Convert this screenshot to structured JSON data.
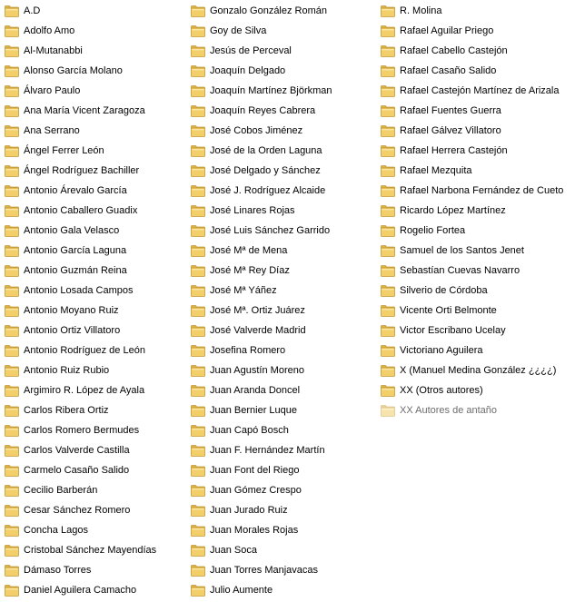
{
  "folder_icon": {
    "name": "folder-icon",
    "colors": {
      "tab": "#dcb24a",
      "body": "#f2cf6a",
      "edge": "#c29a34",
      "shine": "#fbe6a3"
    }
  },
  "columns": [
    {
      "items": [
        {
          "label": "A.D"
        },
        {
          "label": "Adolfo Amo"
        },
        {
          "label": "Al-Mutanabbi"
        },
        {
          "label": "Alonso García Molano"
        },
        {
          "label": "Álvaro Paulo"
        },
        {
          "label": "Ana María Vicent Zaragoza"
        },
        {
          "label": "Ana Serrano"
        },
        {
          "label": "Ángel Ferrer León"
        },
        {
          "label": "Ángel Rodríguez Bachiller"
        },
        {
          "label": "Antonio Árevalo García"
        },
        {
          "label": "Antonio Caballero Guadix"
        },
        {
          "label": "Antonio Gala Velasco"
        },
        {
          "label": "Antonio García Laguna"
        },
        {
          "label": "Antonio Guzmán Reina"
        },
        {
          "label": "Antonio Losada Campos"
        },
        {
          "label": "Antonio Moyano Ruiz"
        },
        {
          "label": "Antonio Ortiz Villatoro"
        },
        {
          "label": "Antonio Rodríguez de León"
        },
        {
          "label": "Antonio Ruiz Rubio"
        },
        {
          "label": "Argimiro R. López de Ayala"
        },
        {
          "label": "Carlos Ribera Ortiz"
        },
        {
          "label": "Carlos Romero Bermudes"
        },
        {
          "label": "Carlos Valverde Castilla"
        },
        {
          "label": "Carmelo Casaño Salido"
        },
        {
          "label": "Cecilio Barberán"
        },
        {
          "label": "Cesar Sánchez Romero"
        },
        {
          "label": "Concha Lagos"
        },
        {
          "label": "Cristobal Sánchez Mayendías"
        },
        {
          "label": "Dámaso Torres"
        },
        {
          "label": "Daniel Aguilera Camacho"
        }
      ]
    },
    {
      "items": [
        {
          "label": "Gonzalo González Román"
        },
        {
          "label": "Goy de Silva"
        },
        {
          "label": "Jesús de Perceval"
        },
        {
          "label": "Joaquín Delgado"
        },
        {
          "label": "Joaquín Martínez Björkman"
        },
        {
          "label": "Joaquín Reyes Cabrera"
        },
        {
          "label": "José Cobos Jiménez"
        },
        {
          "label": "José de la Orden Laguna"
        },
        {
          "label": "José Delgado y Sánchez"
        },
        {
          "label": "José J. Rodríguez Alcaide"
        },
        {
          "label": "José Linares Rojas"
        },
        {
          "label": "José Luis Sánchez Garrido"
        },
        {
          "label": "José Mª de Mena"
        },
        {
          "label": "José Mª Rey Díaz"
        },
        {
          "label": "José Mª Yáñez"
        },
        {
          "label": "José Mª. Ortiz Juárez"
        },
        {
          "label": "José Valverde Madrid"
        },
        {
          "label": "Josefina Romero"
        },
        {
          "label": "Juan Agustín Moreno"
        },
        {
          "label": "Juan Aranda Doncel"
        },
        {
          "label": "Juan Bernier Luque"
        },
        {
          "label": "Juan Capó Bosch"
        },
        {
          "label": "Juan F. Hernández Martín"
        },
        {
          "label": "Juan Font del Riego"
        },
        {
          "label": "Juan Gómez Crespo"
        },
        {
          "label": "Juan Jurado Ruiz"
        },
        {
          "label": "Juan Morales Rojas"
        },
        {
          "label": "Juan Soca"
        },
        {
          "label": "Juan Torres Manjavacas"
        },
        {
          "label": "Julio Aumente"
        }
      ]
    },
    {
      "items": [
        {
          "label": "R. Molina"
        },
        {
          "label": "Rafael Aguilar Priego"
        },
        {
          "label": "Rafael Cabello Castejón"
        },
        {
          "label": "Rafael Casaño Salido"
        },
        {
          "label": "Rafael Castejón Martínez de Arizala"
        },
        {
          "label": "Rafael Fuentes Guerra"
        },
        {
          "label": "Rafael Gálvez Villatoro"
        },
        {
          "label": "Rafael Herrera Castejón"
        },
        {
          "label": "Rafael Mezquita"
        },
        {
          "label": "Rafael Narbona Fernández de Cueto"
        },
        {
          "label": "Ricardo López Martínez"
        },
        {
          "label": "Rogelio Fortea"
        },
        {
          "label": "Samuel de los Santos Jenet"
        },
        {
          "label": "Sebastían Cuevas Navarro"
        },
        {
          "label": "Silverio de Córdoba"
        },
        {
          "label": "Vicente Orti Belmonte"
        },
        {
          "label": "Victor Escribano Ucelay"
        },
        {
          "label": "Victoriano Aguilera"
        },
        {
          "label": "X (Manuel Medina González ¿¿¿¿)"
        },
        {
          "label": "XX (Otros autores)"
        },
        {
          "label": "XX Autores de antaño",
          "state": "dimmed"
        }
      ]
    }
  ]
}
